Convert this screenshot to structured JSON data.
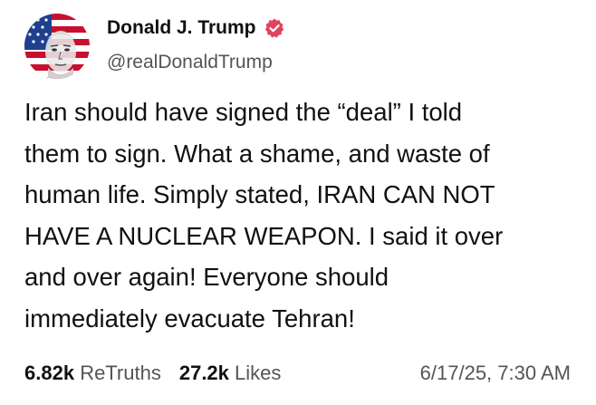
{
  "author": {
    "display_name": "Donald J. Trump",
    "handle": "@realDonaldTrump",
    "verified_icon": "verified-badge-icon",
    "verified_color": "#e0435f"
  },
  "post": {
    "lines": [
      "Iran should have signed the “deal” I told",
      "them to sign. What a shame, and waste of",
      "human life. Simply stated, IRAN CAN NOT",
      "HAVE A NUCLEAR WEAPON. I said it over",
      "and over again! Everyone should",
      "immediately evacuate Tehran!"
    ]
  },
  "stats": {
    "retruths_count": "6.82k",
    "retruths_label": "ReTruths",
    "likes_count": "27.2k",
    "likes_label": "Likes",
    "timestamp": "6/17/25, 7:30 AM"
  }
}
